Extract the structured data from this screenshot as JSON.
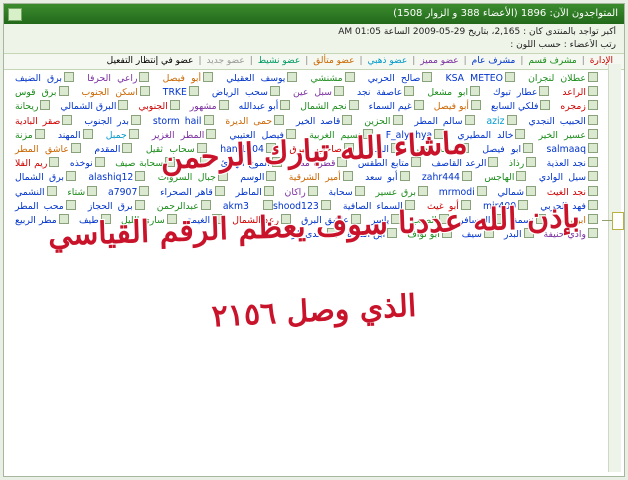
{
  "header": {
    "online_now": "المتواجدون الآن: 1896 (الأعضاء 388 و الزوار 1508)"
  },
  "stats": {
    "record_line": "أكبر تواجد بالمنتدى كان : 2,165، بتاريخ 29-05-2009 الساعة 01:05 AM",
    "newest_member": "رتب الأعضاء : حسب اللون :"
  },
  "legend": [
    {
      "label": "الإدارة",
      "color": "#d10000"
    },
    {
      "label": "مشرف قسم",
      "color": "#1a8c1a"
    },
    {
      "label": "مشرف عام",
      "color": "#0033cc"
    },
    {
      "label": "عضو مميز",
      "color": "#7a2ea0"
    },
    {
      "label": "عضو ذهبي",
      "color": "#0099cc"
    },
    {
      "label": "عضو متألق",
      "color": "#cc6600"
    },
    {
      "label": "عضو نشيط",
      "color": "#009966"
    },
    {
      "label": "عضو جديد",
      "color": "#999999"
    },
    {
      "label": "عضو في إنتظار التفعيل",
      "color": "#000000"
    }
  ],
  "members": [
    {
      "name": "عطلان لنجران",
      "color": "#1a8c1a"
    },
    {
      "name": "KSA METEO",
      "color": "#0033cc"
    },
    {
      "name": "صالح الحربي",
      "color": "#0033cc"
    },
    {
      "name": "مشنشي",
      "color": "#1a8c1a"
    },
    {
      "name": "يوسف العقيلي",
      "color": "#0033cc"
    },
    {
      "name": "أبو فيصل",
      "color": "#cc6600"
    },
    {
      "name": "راعي الحرفا",
      "color": "#7a2ea0"
    },
    {
      "name": "برق الضيف",
      "color": "#0033cc"
    },
    {
      "name": "الراعد",
      "color": "#d10000"
    },
    {
      "name": "عطار تبوك",
      "color": "#0033cc"
    },
    {
      "name": "ابو مشعل",
      "color": "#1a8c1a"
    },
    {
      "name": "عاصفة نجد",
      "color": "#0033cc"
    },
    {
      "name": "سبل عين",
      "color": "#7a2ea0"
    },
    {
      "name": "سحب الرياض",
      "color": "#0033cc"
    },
    {
      "name": "TRKE",
      "color": "#0033cc"
    },
    {
      "name": "اسكن الجنوب",
      "color": "#cc6600"
    },
    {
      "name": "برق قوس",
      "color": "#1a8c1a"
    },
    {
      "name": "زمجره",
      "color": "#d10000"
    },
    {
      "name": "فلكي السابع",
      "color": "#0033cc"
    },
    {
      "name": "أبو فيصل",
      "color": "#cc6600"
    },
    {
      "name": "غيم السماء",
      "color": "#0033cc"
    },
    {
      "name": "نجم الشمال",
      "color": "#1a8c1a"
    },
    {
      "name": "أبو عبدالله",
      "color": "#0033cc"
    },
    {
      "name": "مشهور",
      "color": "#7a2ea0"
    },
    {
      "name": "الجنوبي",
      "color": "#d10000"
    },
    {
      "name": "البرق الشمالي",
      "color": "#0033cc"
    },
    {
      "name": "ريحانة",
      "color": "#1a8c1a"
    },
    {
      "name": "الحبيب النجدي",
      "color": "#0033cc"
    },
    {
      "name": "aziz",
      "color": "#0099cc"
    },
    {
      "name": "سالم المطر",
      "color": "#0033cc"
    },
    {
      "name": "الحزين",
      "color": "#1a8c1a"
    },
    {
      "name": "قاصد الخير",
      "color": "#0033cc"
    },
    {
      "name": "حمى الديرة",
      "color": "#cc6600"
    },
    {
      "name": "storm hail",
      "color": "#0033cc"
    },
    {
      "name": "بدر الجنوب",
      "color": "#0033cc"
    },
    {
      "name": "صقر البادية",
      "color": "#d10000"
    },
    {
      "name": "عسير الخير",
      "color": "#1a8c1a"
    },
    {
      "name": "خالد المطيري",
      "color": "#0033cc"
    },
    {
      "name": "F_alyahya",
      "color": "#0033cc"
    },
    {
      "name": "نسيم الغربية",
      "color": "#1a8c1a"
    },
    {
      "name": "فيصل العتيبي",
      "color": "#0033cc"
    },
    {
      "name": "المطر الغزير",
      "color": "#7a2ea0"
    },
    {
      "name": "جمبل",
      "color": "#0099cc"
    },
    {
      "name": "المهند",
      "color": "#0033cc"
    },
    {
      "name": "مزنة",
      "color": "#1a8c1a"
    },
    {
      "name": "salmaaq",
      "color": "#0033cc"
    },
    {
      "name": "ابو فيصل",
      "color": "#0033cc"
    },
    {
      "name": "غيث الخير",
      "color": "#1a8c1a"
    },
    {
      "name": "الودق",
      "color": "#0033cc"
    },
    {
      "name": "صاحب البرق",
      "color": "#d10000"
    },
    {
      "name": "hani1004",
      "color": "#0033cc"
    },
    {
      "name": "سحاب ثقيل",
      "color": "#1a8c1a"
    },
    {
      "name": "المقدم",
      "color": "#0033cc"
    },
    {
      "name": "عاشق المطر",
      "color": "#cc6600"
    },
    {
      "name": "نجد العذية",
      "color": "#0033cc"
    },
    {
      "name": "رذاذ",
      "color": "#1a8c1a"
    },
    {
      "name": "الرعد القاصف",
      "color": "#0033cc"
    },
    {
      "name": "متابع الطقس",
      "color": "#0033cc"
    },
    {
      "name": "قطرة مطر",
      "color": "#7a2ea0"
    },
    {
      "name": "الموج الهادئ",
      "color": "#0033cc"
    },
    {
      "name": "Itti",
      "color": "#0033cc"
    },
    {
      "name": "سحابة صيف",
      "color": "#1a8c1a"
    },
    {
      "name": "نوخذه",
      "color": "#0033cc"
    },
    {
      "name": "ريم الفلا",
      "color": "#d10000"
    },
    {
      "name": "سيل الوادي",
      "color": "#0033cc"
    },
    {
      "name": "الهاجس",
      "color": "#1a8c1a"
    },
    {
      "name": "zahr444",
      "color": "#0033cc"
    },
    {
      "name": "أبو سعد",
      "color": "#0033cc"
    },
    {
      "name": "أمير الشرقية",
      "color": "#cc6600"
    },
    {
      "name": "الوسم",
      "color": "#0033cc"
    },
    {
      "name": "جبال السروات",
      "color": "#1a8c1a"
    },
    {
      "name": "alashiq12",
      "color": "#0033cc"
    },
    {
      "name": "برق الشمال",
      "color": "#0033cc"
    },
    {
      "name": "نجد الغيث",
      "color": "#d10000"
    },
    {
      "name": "شمالي",
      "color": "#0033cc"
    },
    {
      "name": "mrmodi",
      "color": "#0033cc"
    },
    {
      "name": "برق عسير",
      "color": "#1a8c1a"
    },
    {
      "name": "سحابة",
      "color": "#0033cc"
    },
    {
      "name": "راكان",
      "color": "#7a2ea0"
    },
    {
      "name": "الماطر",
      "color": "#0033cc"
    },
    {
      "name": "قاهر الصحراء",
      "color": "#0033cc"
    },
    {
      "name": "a7907",
      "color": "#0033cc"
    },
    {
      "name": "شتاء",
      "color": "#1a8c1a"
    },
    {
      "name": "النشمي",
      "color": "#0033cc"
    },
    {
      "name": "فهد الحربي",
      "color": "#0033cc"
    },
    {
      "name": "mir400",
      "color": "#0033cc"
    },
    {
      "name": "أبو غيث",
      "color": "#d10000"
    },
    {
      "name": "السماء الصافية",
      "color": "#0033cc"
    },
    {
      "name": "akm3",
      "color": "#0033cc"
    },
    {
      "name": "shood123",
      "color": "#0033cc"
    },
    {
      "name": "عبدالرحمن",
      "color": "#1a8c1a"
    },
    {
      "name": "برق الحجاز",
      "color": "#0033cc"
    },
    {
      "name": "محب المطر",
      "color": "#0033cc"
    },
    {
      "name": "ابو ريان",
      "color": "#cc6600"
    },
    {
      "name": "نسمة",
      "color": "#0033cc"
    },
    {
      "name": "المسافر",
      "color": "#0033cc"
    },
    {
      "name": "الصيب",
      "color": "#1a8c1a"
    },
    {
      "name": "ياسر",
      "color": "#0033cc"
    },
    {
      "name": "عاشق البرق",
      "color": "#0033cc"
    },
    {
      "name": "رعد الشمال",
      "color": "#d10000"
    },
    {
      "name": "الغيمة",
      "color": "#0033cc"
    },
    {
      "name": "ساري الليل",
      "color": "#1a8c1a"
    },
    {
      "name": "طيف",
      "color": "#0033cc"
    },
    {
      "name": "مطر الربيع",
      "color": "#0033cc"
    },
    {
      "name": "وادي حنيفة",
      "color": "#7a2ea0"
    },
    {
      "name": "البدر",
      "color": "#0033cc"
    },
    {
      "name": "سيف",
      "color": "#0033cc"
    },
    {
      "name": "أبو نواف",
      "color": "#1a8c1a"
    },
    {
      "name": "ابن الديرة",
      "color": "#0033cc"
    },
    {
      "name": "صدى الرعد",
      "color": "#0033cc"
    }
  ],
  "overlay": {
    "line1": "ماشاء الله تبارك الرحمن",
    "line2": "بإذن الله عددنا سوف يعظم الرقم القياسي",
    "line3": "الذي وصل ٢١٥٦"
  }
}
